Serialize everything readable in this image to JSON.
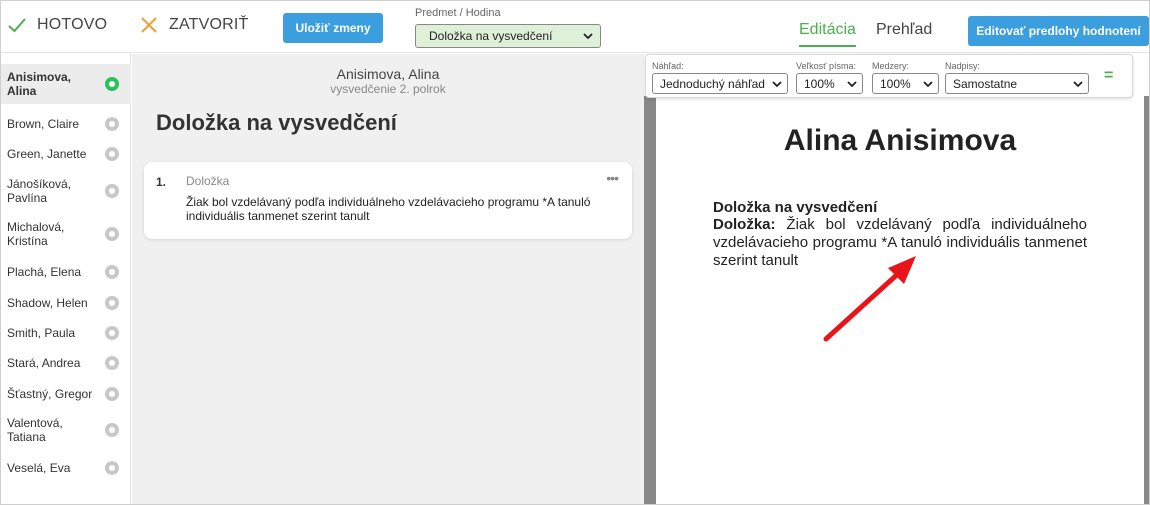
{
  "topbar": {
    "done_label": "HOTOVO",
    "close_label": "ZATVORIŤ",
    "save_label": "Uložiť zmeny",
    "subject_label": "Predmet / Hodina",
    "subject_value": "Doložka na vysvedčení",
    "tabs": [
      {
        "label": "Editácia",
        "active": true
      },
      {
        "label": "Prehľad",
        "active": false
      }
    ],
    "edit_templates_label": "Editovať predlohy hodnotení"
  },
  "students": [
    {
      "name": "Anisimova, Alina",
      "active": true
    },
    {
      "name": "Brown, Claire",
      "active": false
    },
    {
      "name": "Green, Janette",
      "active": false
    },
    {
      "name": "Jánošíková, Pavlína",
      "active": false
    },
    {
      "name": "Michalová, Kristína",
      "active": false
    },
    {
      "name": "Plachá, Elena",
      "active": false
    },
    {
      "name": "Shadow, Helen",
      "active": false
    },
    {
      "name": "Smith, Paula",
      "active": false
    },
    {
      "name": "Stará, Andrea",
      "active": false
    },
    {
      "name": "Šťastný, Gregor",
      "active": false
    },
    {
      "name": "Valentová, Tatiana",
      "active": false
    },
    {
      "name": "Veselá, Eva",
      "active": false
    }
  ],
  "middle": {
    "student_name": "Anisimova, Alina",
    "subtitle": "vysvedčenie 2. polrok",
    "title": "Doložka na vysvedčení",
    "card": {
      "number": "1.",
      "label": "Doložka",
      "more": "•••",
      "text": "Žiak bol vzdelávaný podľa individuálneho vzdelávacieho programu *A tanuló individuális tanmenet szerint tanult"
    }
  },
  "preview_toolbar": {
    "view_label": "Náhľad:",
    "view_value": "Jednoduchý náhľad",
    "font_size_label": "Veľkosť písma:",
    "font_size_value": "100%",
    "spacing_label": "Medzery:",
    "spacing_value": "100%",
    "captions_label": "Nadpisy:",
    "captions_value": "Samostatne",
    "menu_icon": "="
  },
  "preview": {
    "student_name": "Alina Anisimova",
    "heading": "Doložka na vysvedčení",
    "field_label": "Doložka:",
    "field_text": "Žiak bol vzdelávaný podľa individuálneho vzdelávacieho programu *A tanuló individuális tanmenet szerint tanult"
  },
  "colors": {
    "accent_green": "#4cae4c",
    "primary_blue": "#3b9ede",
    "active_radio": "#26c45a",
    "annotation_arrow": "#e8141a"
  },
  "icons": [
    "checkmark-icon",
    "close-x-icon",
    "chevron-down-icon",
    "radio-icon",
    "more-dots-icon",
    "equals-icon",
    "annotation-arrow"
  ]
}
